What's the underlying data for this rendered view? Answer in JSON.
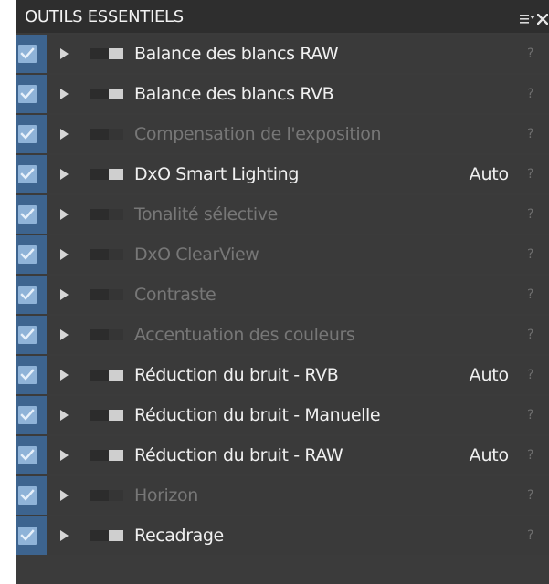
{
  "panel": {
    "title": "OUTILS ESSENTIELS",
    "menu_icon": "list-menu-icon",
    "close_icon": "close-icon",
    "colors": {
      "background": "#3b3b3b",
      "header": "#2e2e2e",
      "check_column": "#3d648f",
      "checkbox": "#8fb3d8",
      "active_text": "#f0f0f0",
      "inactive_text": "#777777"
    }
  },
  "tools": [
    {
      "label": "Balance des blancs RAW",
      "checked": true,
      "enabled": true,
      "status": "",
      "help": "?"
    },
    {
      "label": "Balance des blancs RVB",
      "checked": true,
      "enabled": true,
      "status": "",
      "help": "?"
    },
    {
      "label": "Compensation de l'exposition",
      "checked": true,
      "enabled": false,
      "status": "",
      "help": "?"
    },
    {
      "label": "DxO Smart Lighting",
      "checked": true,
      "enabled": true,
      "status": "Auto",
      "help": "?"
    },
    {
      "label": "Tonalité sélective",
      "checked": true,
      "enabled": false,
      "status": "",
      "help": "?"
    },
    {
      "label": "DxO ClearView",
      "checked": true,
      "enabled": false,
      "status": "",
      "help": "?"
    },
    {
      "label": "Contraste",
      "checked": true,
      "enabled": false,
      "status": "",
      "help": "?"
    },
    {
      "label": "Accentuation des couleurs",
      "checked": true,
      "enabled": false,
      "status": "",
      "help": "?"
    },
    {
      "label": "Réduction du bruit - RVB",
      "checked": true,
      "enabled": true,
      "status": "Auto",
      "help": "?"
    },
    {
      "label": "Réduction du bruit - Manuelle",
      "checked": true,
      "enabled": true,
      "status": "",
      "help": "?"
    },
    {
      "label": "Réduction du bruit - RAW",
      "checked": true,
      "enabled": true,
      "status": "Auto",
      "help": "?"
    },
    {
      "label": "Horizon",
      "checked": true,
      "enabled": false,
      "status": "",
      "help": "?"
    },
    {
      "label": "Recadrage",
      "checked": true,
      "enabled": true,
      "status": "",
      "help": "?"
    }
  ]
}
